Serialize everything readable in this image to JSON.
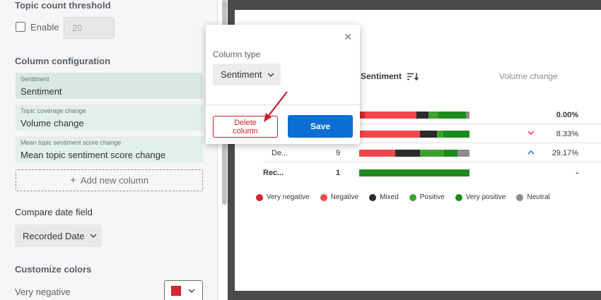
{
  "left_panel": {
    "topic_threshold": {
      "title": "Topic count threshold",
      "enable_label": "Enable",
      "value": "20"
    },
    "column_configuration": {
      "title": "Column configuration",
      "columns": [
        {
          "type": "Sentiment",
          "value": "Sentiment"
        },
        {
          "type": "Topic coverage change",
          "value": "Volume change"
        },
        {
          "type": "Mean topic sentiment score change",
          "value": "Mean topic sentiment score change"
        }
      ],
      "add_label": "Add new column"
    },
    "compare_date": {
      "title": "Compare date field",
      "value": "Recorded Date"
    },
    "customize_colors": {
      "title": "Customize colors",
      "first_label": "Very negative",
      "first_color": "#d9282f"
    }
  },
  "popup": {
    "column_type_label": "Column type",
    "selected_type": "Sentiment",
    "delete_label_line1": "Delete",
    "delete_label_line2": "column",
    "save_label": "Save"
  },
  "preview": {
    "headers": {
      "sentiment": "Sentiment",
      "volume": "Volume change"
    },
    "rows": [
      {
        "name": "",
        "count": "",
        "change": "0.00%",
        "trend": "",
        "bar": [
          5,
          47,
          11,
          9,
          25,
          3
        ]
      },
      {
        "name": "",
        "count": "",
        "change": "8.33%",
        "trend": "down",
        "bar": [
          0,
          56,
          16,
          6,
          24,
          0
        ]
      },
      {
        "name": "De...",
        "count": "9",
        "change": "29.17%",
        "trend": "up",
        "bar": [
          0,
          33,
          22,
          22,
          12,
          11
        ]
      },
      {
        "name": "Rec...",
        "count": "1",
        "change": "-",
        "trend": "",
        "bar": [
          0,
          0,
          0,
          0,
          100,
          0
        ]
      }
    ],
    "legend": [
      {
        "label": "Very negative",
        "color": "#d9282f"
      },
      {
        "label": "Negative",
        "color": "#f0474c"
      },
      {
        "label": "Mixed",
        "color": "#2b2b2b"
      },
      {
        "label": "Positive",
        "color": "#3fa12d"
      },
      {
        "label": "Very positive",
        "color": "#1d8a1d"
      },
      {
        "label": "Neutral",
        "color": "#8c8c8c"
      }
    ]
  }
}
